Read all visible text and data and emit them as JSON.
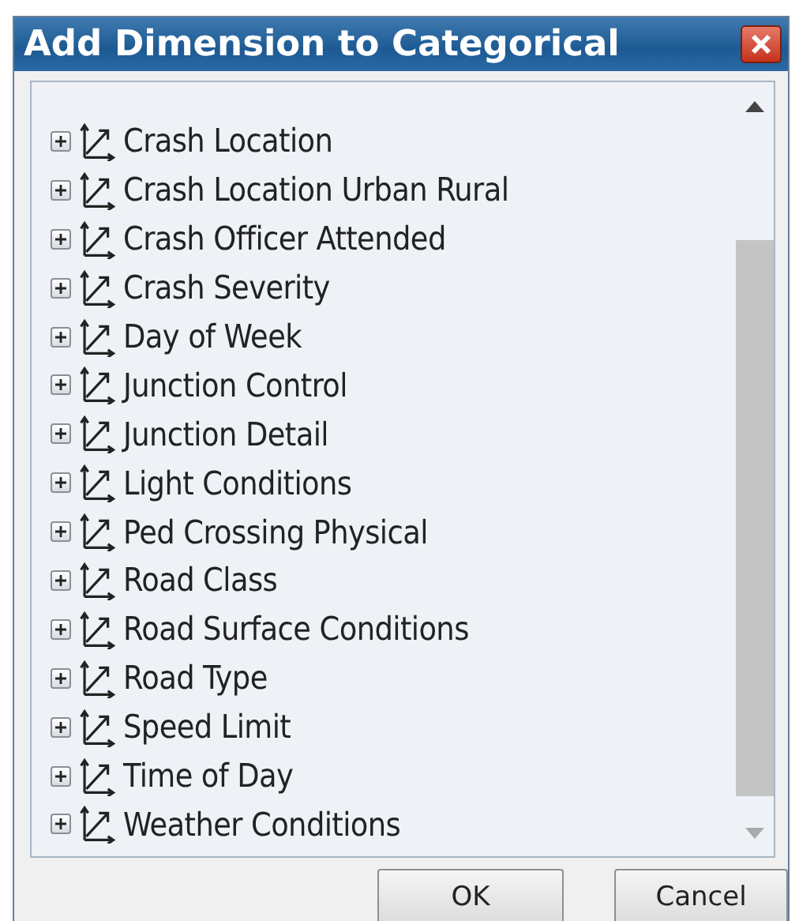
{
  "window": {
    "title": "Add Dimension to Categorical"
  },
  "tree": {
    "items": [
      {
        "label": "Crash Location",
        "expanded": false
      },
      {
        "label": "Crash Location Urban Rural",
        "expanded": false
      },
      {
        "label": "Crash Officer Attended",
        "expanded": false
      },
      {
        "label": "Crash Severity",
        "expanded": false
      },
      {
        "label": "Day of Week",
        "expanded": false
      },
      {
        "label": "Junction Control",
        "expanded": false
      },
      {
        "label": "Junction Detail",
        "expanded": false
      },
      {
        "label": "Light Conditions",
        "expanded": false
      },
      {
        "label": "Ped Crossing Physical",
        "expanded": false
      },
      {
        "label": "Road Class",
        "expanded": false
      },
      {
        "label": "Road Surface Conditions",
        "expanded": false
      },
      {
        "label": "Road Type",
        "expanded": false
      },
      {
        "label": "Speed Limit",
        "expanded": false
      },
      {
        "label": "Time of Day",
        "expanded": false
      },
      {
        "label": "Weather Conditions",
        "expanded": false
      }
    ]
  },
  "buttons": [
    "OK",
    "Cancel"
  ]
}
